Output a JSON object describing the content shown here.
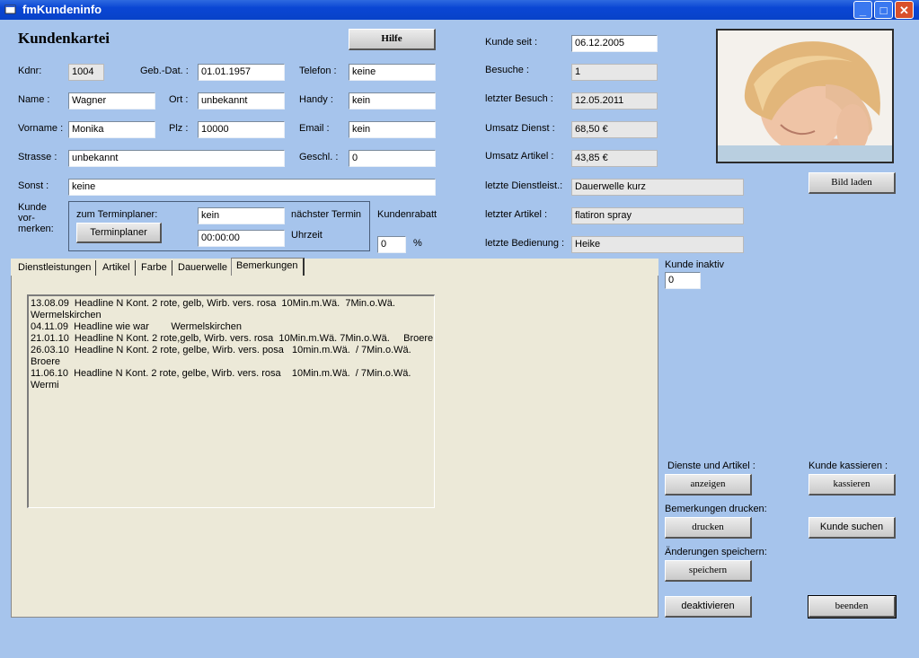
{
  "window": {
    "title": "fmKundeninfo",
    "controls": {
      "minimize": "_",
      "maximize": "□",
      "close": "✕"
    }
  },
  "header": {
    "title": "Kundenkartei",
    "help_label": "Hilfe"
  },
  "customer": {
    "kdnr_label": "Kdnr:",
    "kdnr": "1004",
    "gebdat_label": "Geb.-Dat. :",
    "gebdat": "01.01.1957",
    "telefon_label": "Telefon :",
    "telefon": "keine",
    "name_label": "Name :",
    "name": "Wagner",
    "ort_label": "Ort :",
    "ort": "unbekannt",
    "handy_label": "Handy :",
    "handy": "kein",
    "vorname_label": "Vorname :",
    "vorname": "Monika",
    "plz_label": "Plz :",
    "plz": "10000",
    "email_label": "Email :",
    "email": "kein",
    "strasse_label": "Strasse :",
    "strasse": "unbekannt",
    "geschl_label": "Geschl. :",
    "geschl": "0",
    "sonst_label": "Sonst :",
    "sonst": "keine"
  },
  "booking": {
    "label_line1": "Kunde",
    "label_line2": "vor-",
    "label_line3": "merken:",
    "planner_label": "zum Terminplaner:",
    "planner_button": "Terminplaner",
    "next_value": "kein",
    "next_label": "nächster Termin",
    "time_value": "00:00:00",
    "time_label": "Uhrzeit"
  },
  "discount": {
    "label": "Kundenrabatt",
    "value": "0",
    "unit": "%"
  },
  "stats": {
    "since_label": "Kunde seit :",
    "since": "06.12.2005",
    "visits_label": "Besuche :",
    "visits": "1",
    "last_visit_label": "letzter Besuch :",
    "last_visit": "12.05.2011",
    "service_revenue_label": "Umsatz Dienst :",
    "service_revenue": "68,50 €",
    "article_revenue_label": "Umsatz Artikel :",
    "article_revenue": "43,85 €",
    "last_service_label": "letzte Dienstleist.:",
    "last_service": "Dauerwelle kurz",
    "last_article_label": "letzter Artikel :",
    "last_article": "flatiron spray",
    "last_staff_label": "letzte Bedienung :",
    "last_staff": "Heike"
  },
  "photo": {
    "load_button": "Bild laden"
  },
  "inactive": {
    "label": "Kunde inaktiv",
    "value": "0"
  },
  "tabs": [
    {
      "label": "Dienstleistungen"
    },
    {
      "label": "Artikel"
    },
    {
      "label": "Farbe"
    },
    {
      "label": "Dauerwelle"
    },
    {
      "label": "Bemerkungen"
    }
  ],
  "notes": [
    "13.08.09  Headline N Kont. 2 rote, gelb, Wirb. vers. rosa  10Min.m.Wä.  7Min.o.Wä.",
    "Wermelskirchen",
    "04.11.09  Headline wie war        Wermelskirchen",
    "21.01.10  Headline N Kont. 2 rote,gelb, Wirb. vers. rosa  10Min.m.Wä. 7Min.o.Wä.     Broere",
    "26.03.10  Headline N Kont. 2 rote, gelbe, Wirb. vers. posa   10min.m.Wä.  / 7Min.o.Wä.",
    "Broere",
    "11.06.10  Headline N Kont. 2 rote, gelbe, Wirb. vers. rosa    10Min.m.Wä.  / 7Min.o.Wä.",
    "Wermi"
  ],
  "actions": {
    "services_label": "Dienste und Artikel :",
    "show_button": "anzeigen",
    "checkout_label": "Kunde kassieren :",
    "checkout_button": "kassieren",
    "print_label": "Bemerkungen drucken:",
    "print_button": "drucken",
    "search_button": "Kunde suchen",
    "save_label": "Änderungen speichern:",
    "save_button": "speichern",
    "deactivate_button": "deaktivieren",
    "exit_button": "beenden"
  }
}
